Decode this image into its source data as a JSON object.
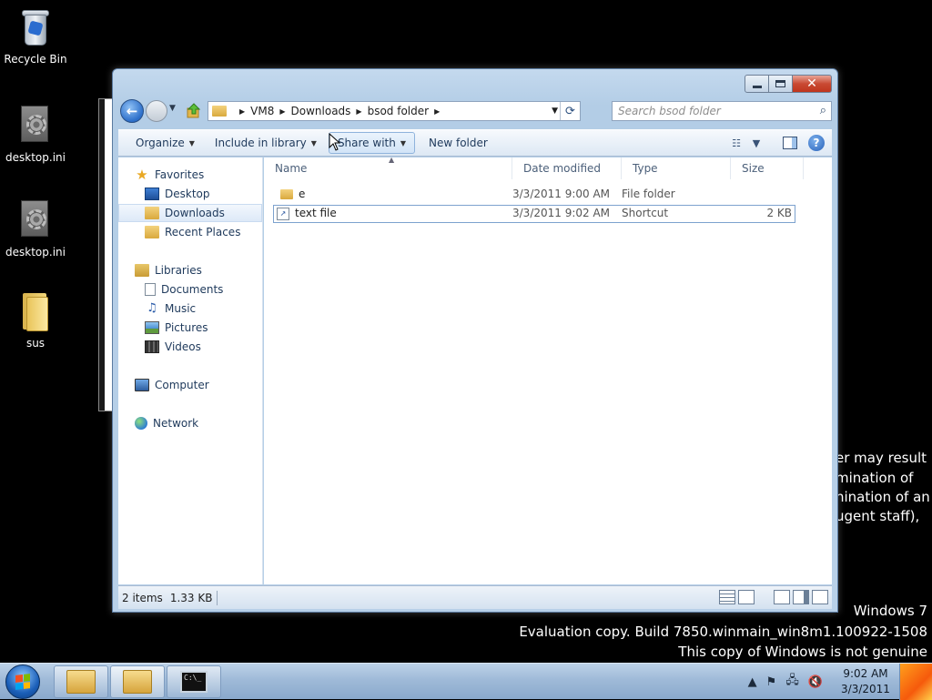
{
  "desktop": {
    "icons": [
      {
        "label": "Recycle Bin"
      },
      {
        "label": "desktop.ini"
      },
      {
        "label": "desktop.ini"
      },
      {
        "label": "sus"
      }
    ],
    "watermark": {
      "line1": "Windows 7",
      "line2": "Evaluation copy. Build 7850.winmain_win8m1.100922-1508",
      "line3": "This copy of Windows is not genuine"
    },
    "background_text": [
      "er may result",
      "mination of",
      "nination of an",
      "ugent staff),"
    ]
  },
  "explorer": {
    "breadcrumb": [
      "VM8",
      "Downloads",
      "bsod folder"
    ],
    "search_placeholder": "Search bsod folder",
    "toolbar": {
      "organize": "Organize",
      "include_in_library": "Include in library",
      "share_with": "Share with",
      "new_folder": "New folder"
    },
    "nav": {
      "favorites": "Favorites",
      "desktop": "Desktop",
      "downloads": "Downloads",
      "recent_places": "Recent Places",
      "libraries": "Libraries",
      "documents": "Documents",
      "music": "Music",
      "pictures": "Pictures",
      "videos": "Videos",
      "computer": "Computer",
      "network": "Network"
    },
    "columns": {
      "name": "Name",
      "date_modified": "Date modified",
      "type": "Type",
      "size": "Size"
    },
    "files": [
      {
        "name": "e",
        "date": "3/3/2011 9:00 AM",
        "type": "File folder",
        "size": ""
      },
      {
        "name": "text file",
        "date": "3/3/2011 9:02 AM",
        "type": "Shortcut",
        "size": "2 KB"
      }
    ],
    "status": {
      "items": "2 items",
      "size": "1.33 KB"
    }
  },
  "taskbar": {
    "clock_time": "9:02 AM",
    "clock_date": "3/3/2011",
    "cmd_label": "C:\\_"
  },
  "colors": {
    "accent": "#2c6ec9",
    "close_button": "#c94a33",
    "desktop_bg": "#000000"
  }
}
